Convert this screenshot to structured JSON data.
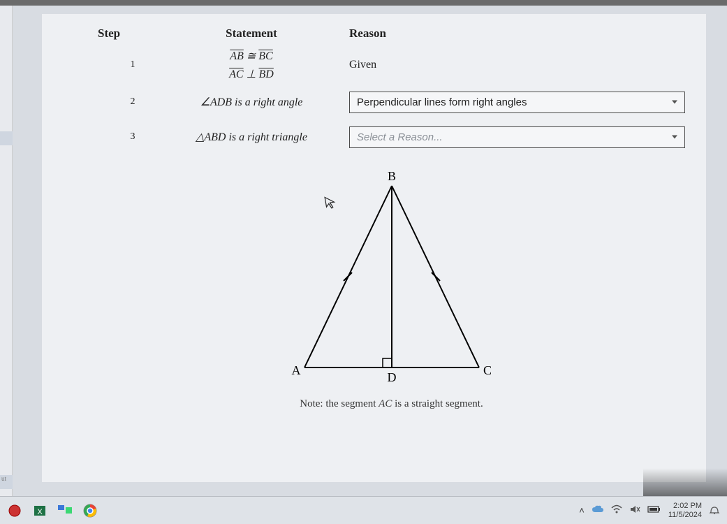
{
  "headers": {
    "step": "Step",
    "statement": "Statement",
    "reason": "Reason"
  },
  "rows": {
    "r1": {
      "step": "1",
      "stmt_a_left": "AB",
      "stmt_a_mid": " ≅ ",
      "stmt_a_right": "BC",
      "stmt_b_left": "AC",
      "stmt_b_mid": " ⊥ ",
      "stmt_b_right": "BD",
      "reason": "Given"
    },
    "r2": {
      "step": "2",
      "stmt": "∠ADB is a right angle",
      "reason": "Perpendicular lines form right angles"
    },
    "r3": {
      "step": "3",
      "stmt": "△ABD is a right triangle",
      "reason_placeholder": "Select a Reason..."
    }
  },
  "note": {
    "prefix": "Note: the segment ",
    "seg": "AC",
    "suffix": " is a straight segment."
  },
  "labels": {
    "A": "A",
    "B": "B",
    "C": "C",
    "D": "D"
  },
  "left_tab": "ut",
  "taskbar": {
    "time": "2:02 PM",
    "date": "11/5/2024"
  },
  "tray_icons": {
    "caret": "^",
    "cloud": "cloud-icon",
    "wifi": "wifi-icon",
    "sound": "sound-muted-icon",
    "battery": "battery-icon",
    "bell": "notification-icon"
  }
}
